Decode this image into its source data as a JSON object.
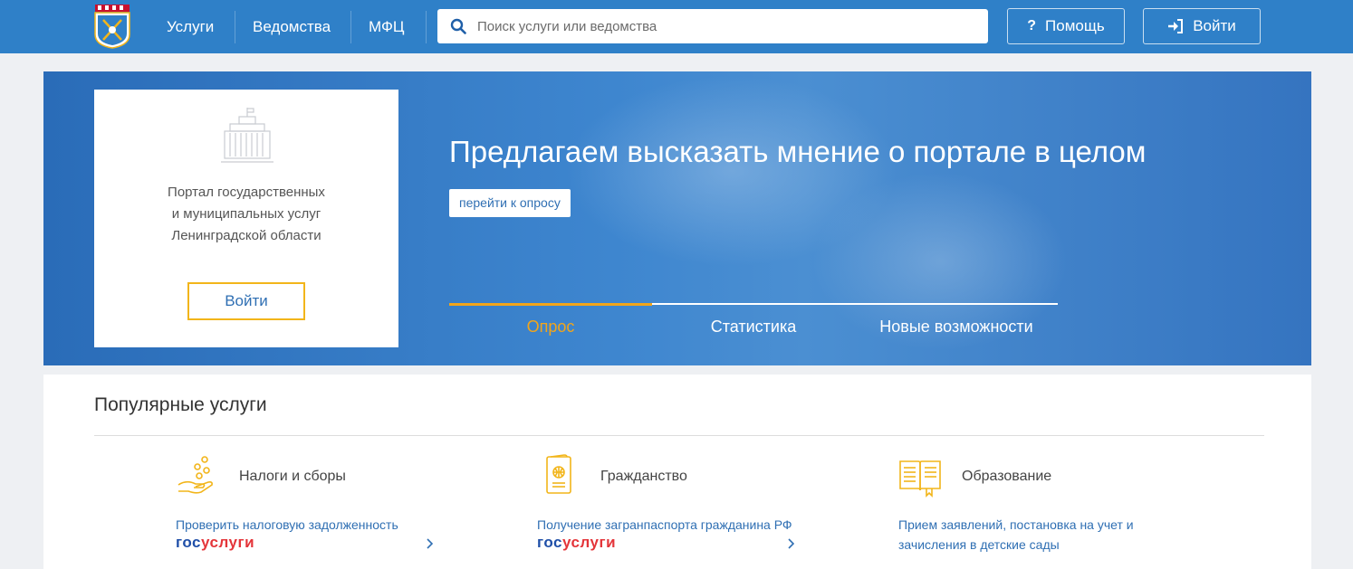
{
  "header": {
    "nav": [
      {
        "label": "Услуги"
      },
      {
        "label": "Ведомства"
      },
      {
        "label": "МФЦ"
      }
    ],
    "search": {
      "placeholder": "Поиск услуги или ведомства"
    },
    "help_label": "Помощь",
    "login_label": "Войти",
    "colors": {
      "bar": "#2f80c8"
    }
  },
  "login_card": {
    "line1": "Портал государственных",
    "line2": "и муниципальных услуг",
    "line3": "Ленинградской области",
    "button": "Войти"
  },
  "hero": {
    "title": "Предлагаем высказать мнение о портале в целом",
    "button": "перейти к опросу",
    "tabs": [
      {
        "label": "Опрос",
        "active": true
      },
      {
        "label": "Статистика",
        "active": false
      },
      {
        "label": "Новые возможности",
        "active": false
      }
    ],
    "accent": "#f2a51a"
  },
  "popular": {
    "title": "Популярные услуги",
    "categories": [
      {
        "title": "Налоги и сборы",
        "icon": "coins-hand-icon",
        "link": "Проверить налоговую задолженность",
        "badge_a": "гос",
        "badge_b": "услуги"
      },
      {
        "title": "Гражданство",
        "icon": "passport-icon",
        "link": "Получение загранпаспорта гражданина РФ",
        "badge_a": "гос",
        "badge_b": "услуги"
      },
      {
        "title": "Образование",
        "icon": "open-book-icon",
        "link_line1": "Прием заявлений, постановка на учет и",
        "link_line2": "зачисления в детские сады"
      }
    ]
  }
}
